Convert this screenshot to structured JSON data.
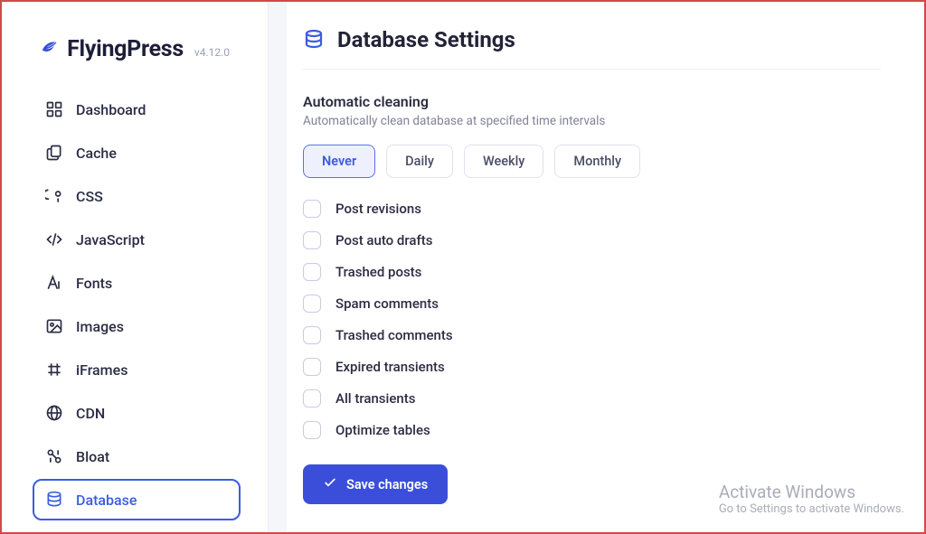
{
  "brand": {
    "name": "FlyingPress",
    "version": "v4.12.0"
  },
  "sidebar": {
    "items": [
      {
        "label": "Dashboard",
        "icon": "dashboard-icon",
        "active": false
      },
      {
        "label": "Cache",
        "icon": "cache-icon",
        "active": false
      },
      {
        "label": "CSS",
        "icon": "css-icon",
        "active": false
      },
      {
        "label": "JavaScript",
        "icon": "javascript-icon",
        "active": false
      },
      {
        "label": "Fonts",
        "icon": "fonts-icon",
        "active": false
      },
      {
        "label": "Images",
        "icon": "images-icon",
        "active": false
      },
      {
        "label": "iFrames",
        "icon": "iframes-icon",
        "active": false
      },
      {
        "label": "CDN",
        "icon": "cdn-icon",
        "active": false
      },
      {
        "label": "Bloat",
        "icon": "bloat-icon",
        "active": false
      },
      {
        "label": "Database",
        "icon": "database-icon",
        "active": true
      }
    ]
  },
  "page": {
    "title": "Database Settings"
  },
  "auto_clean": {
    "title": "Automatic cleaning",
    "description": "Automatically clean database at specified time intervals",
    "options": [
      {
        "label": "Never",
        "selected": true
      },
      {
        "label": "Daily",
        "selected": false
      },
      {
        "label": "Weekly",
        "selected": false
      },
      {
        "label": "Monthly",
        "selected": false
      }
    ]
  },
  "checkboxes": [
    {
      "label": "Post revisions",
      "checked": false
    },
    {
      "label": "Post auto drafts",
      "checked": false
    },
    {
      "label": "Trashed posts",
      "checked": false
    },
    {
      "label": "Spam comments",
      "checked": false
    },
    {
      "label": "Trashed comments",
      "checked": false
    },
    {
      "label": "Expired transients",
      "checked": false
    },
    {
      "label": "All transients",
      "checked": false
    },
    {
      "label": "Optimize tables",
      "checked": false
    }
  ],
  "actions": {
    "save_label": "Save changes"
  },
  "watermark": {
    "title": "Activate Windows",
    "subtitle": "Go to Settings to activate Windows."
  }
}
